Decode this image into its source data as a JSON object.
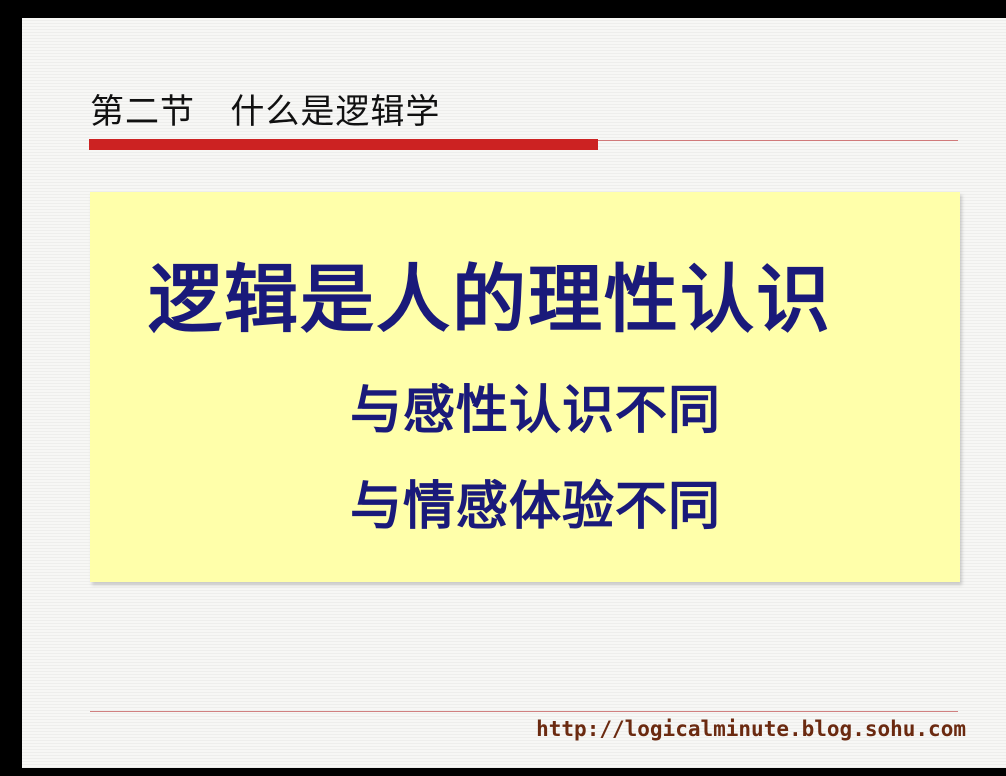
{
  "slide": {
    "section_title": "第二节   什么是逻辑学",
    "main_statement": "逻辑是人的理性认识",
    "sub_points": [
      "与感性认识不同",
      "与情感体验不同"
    ],
    "footer_url": "http://logicalminute.blog.sohu.com"
  },
  "colors": {
    "accent_red": "#cc2222",
    "box_yellow": "#ffffaa",
    "text_navy": "#1a1a7a",
    "url_brown": "#6b2a10"
  }
}
